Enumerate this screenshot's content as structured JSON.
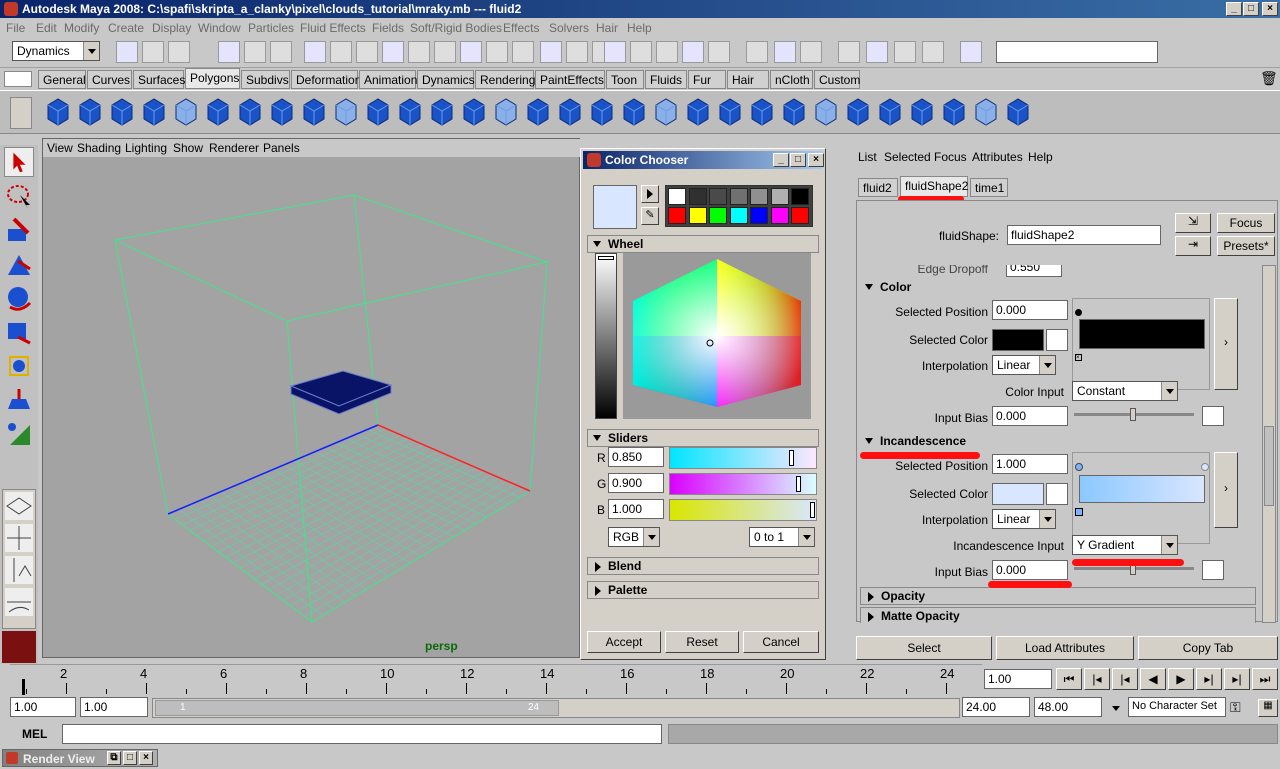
{
  "titlebar": {
    "title": "Autodesk Maya 2008: C:\\spafi\\skripta_a_clanky\\pixel\\clouds_tutorial\\mraky.mb   ---   fluid2"
  },
  "menus": [
    "File",
    "Edit",
    "Modify",
    "Create",
    "Display",
    "Window",
    "Particles",
    "Fluid Effects",
    "Fields",
    "Soft/Rigid Bodies",
    "Effects",
    "Solvers",
    "Hair",
    "Help"
  ],
  "status": {
    "menuset": "Dynamics"
  },
  "shelf_tabs": [
    "General",
    "Curves",
    "Surfaces",
    "Polygons",
    "Subdivs",
    "Deformation",
    "Animation",
    "Dynamics",
    "Rendering",
    "PaintEffects",
    "Toon",
    "Fluids",
    "Fur",
    "Hair",
    "nCloth",
    "Custom"
  ],
  "shelf_active": "Polygons",
  "viewport": {
    "menus": [
      "View",
      "Shading",
      "Lighting",
      "Show",
      "Renderer",
      "Panels"
    ],
    "camera": "persp"
  },
  "color_chooser": {
    "title": "Color Chooser",
    "wheel_label": "Wheel",
    "sliders_label": "Sliders",
    "r_label": "R",
    "g_label": "G",
    "b_label": "B",
    "r": "0.850",
    "g": "0.900",
    "b": "1.000",
    "mode": "RGB",
    "range": "0 to 1",
    "blend_label": "Blend",
    "palette_label": "Palette",
    "accept": "Accept",
    "reset": "Reset",
    "cancel": "Cancel",
    "current_color": "#d9e6ff",
    "swatches_top": [
      "#ffffff",
      "#303030",
      "#4a4a4a",
      "#707070",
      "#909090",
      "#b0b0b0",
      "#000000"
    ],
    "swatches_bottom": [
      "#ff0000",
      "#ffff00",
      "#00ff00",
      "#00ffff",
      "#0000ff",
      "#ff00ff",
      "#ff0000"
    ]
  },
  "attribute_editor": {
    "menus": [
      "List",
      "Selected",
      "Focus",
      "Attributes",
      "Help"
    ],
    "tabs": [
      "fluid2",
      "fluidShape2",
      "time1"
    ],
    "active_tab": "fluidShape2",
    "node_label": "fluidShape:",
    "node_value": "fluidShape2",
    "focus": "Focus",
    "presets": "Presets*",
    "edge_dropoff_label": "Edge Dropoff",
    "edge_dropoff": "0.550",
    "color": {
      "header": "Color",
      "selected_position_label": "Selected Position",
      "selected_position": "0.000",
      "selected_color_label": "Selected Color",
      "interpolation_label": "Interpolation",
      "interpolation": "Linear",
      "input_label": "Color Input",
      "input": "Constant",
      "bias_label": "Input Bias",
      "bias": "0.000"
    },
    "incandescence": {
      "header": "Incandescence",
      "selected_position_label": "Selected Position",
      "selected_position": "1.000",
      "selected_color_label": "Selected Color",
      "interpolation_label": "Interpolation",
      "interpolation": "Linear",
      "input_label": "Incandescence Input",
      "input": "Y Gradient",
      "bias_label": "Input Bias",
      "bias": "0.000"
    },
    "opacity": "Opacity",
    "matte_opacity": "Matte Opacity",
    "buttons": {
      "select": "Select",
      "load": "Load Attributes",
      "copy": "Copy Tab"
    }
  },
  "timeline": {
    "ticks": [
      "2",
      "4",
      "6",
      "8",
      "10",
      "12",
      "14",
      "16",
      "18",
      "20",
      "22",
      "24"
    ],
    "current": "1.00"
  },
  "range": {
    "start": "1.00",
    "start2": "1.00",
    "slider_start": "1",
    "slider_end": "24",
    "end": "24.00",
    "end2": "48.00",
    "character": "No Character Set"
  },
  "command": {
    "label": "MEL"
  },
  "taskbar": {
    "render_view": "Render View"
  }
}
